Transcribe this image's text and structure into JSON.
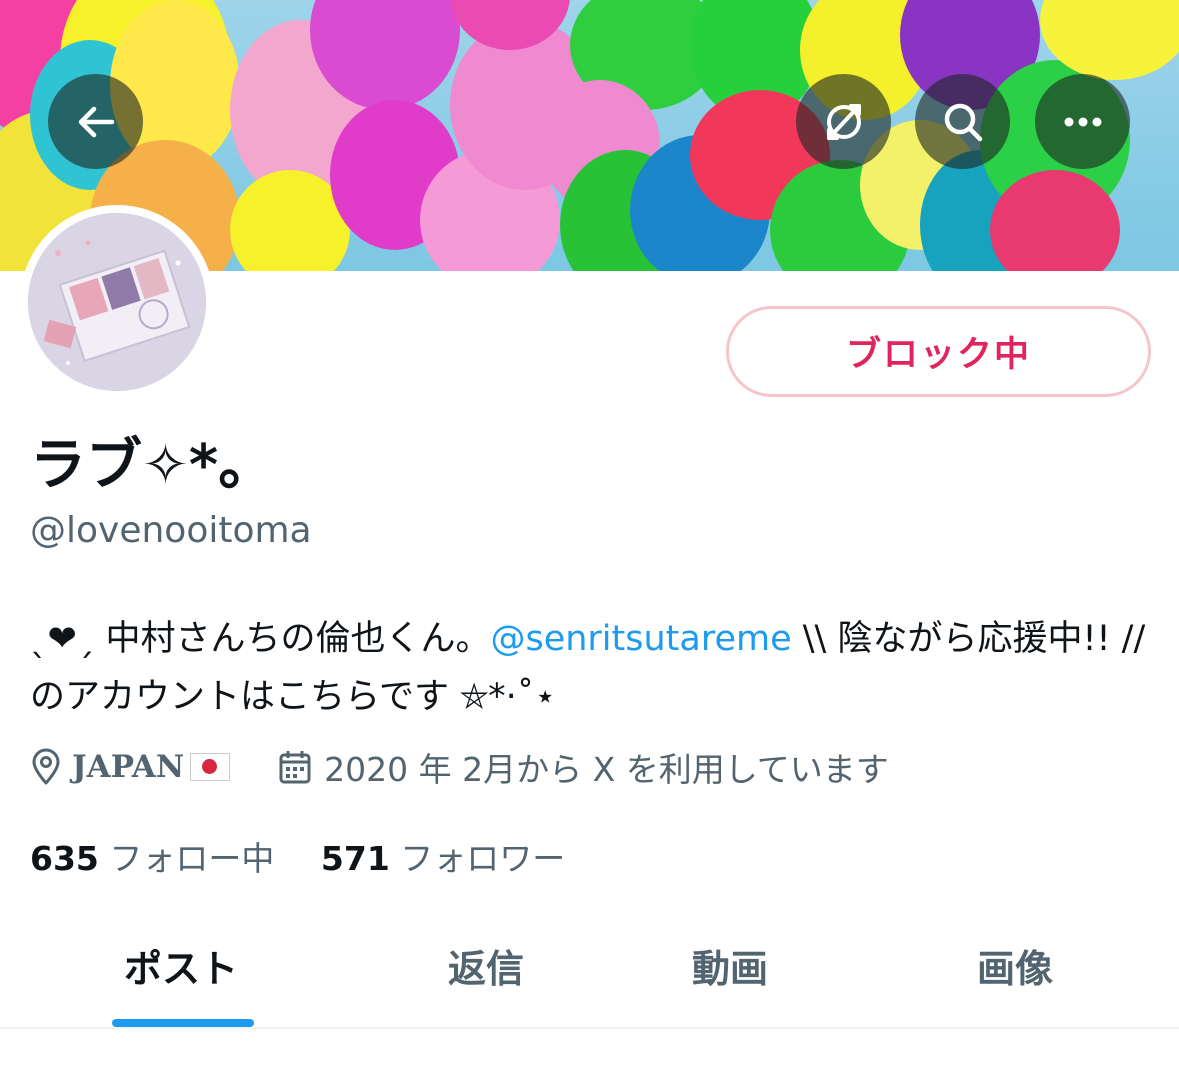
{
  "header": {
    "back_icon": "arrow-left-icon",
    "actions": [
      "translate-icon",
      "search-icon",
      "more-icon"
    ]
  },
  "profile": {
    "display_name": "ラブ✧*。",
    "handle": "@lovenooitoma",
    "block_button_label": "ブロック中",
    "bio": {
      "prefix": "ˎ❤ˏ 中村さんちの倫也くん。",
      "mention": "@senritsutareme",
      "suffix": " \\\\ 陰ながら応援中!! //のアカウントはこちらです ⛤*·˚⋆"
    },
    "location": "JAPAN",
    "joined": "2020 年 2月から X を利用しています",
    "following_count": "635",
    "following_label": "フォロー中",
    "followers_count": "571",
    "followers_label": "フォロワー"
  },
  "tabs": [
    {
      "label": "ポスト",
      "active": true
    },
    {
      "label": "返信",
      "active": false
    },
    {
      "label": "動画",
      "active": false
    },
    {
      "label": "画像",
      "active": false
    }
  ],
  "colors": {
    "accent": "#1d9bf0",
    "block_red": "#e0245e",
    "secondary_text": "#536471"
  }
}
